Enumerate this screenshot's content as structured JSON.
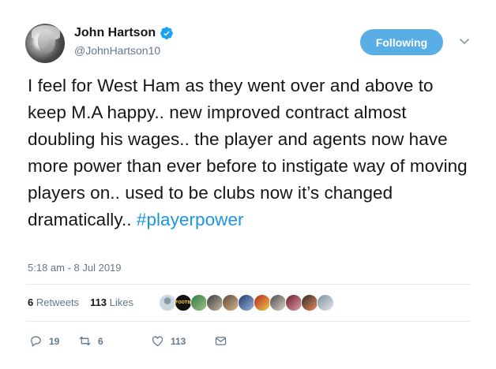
{
  "user": {
    "display_name": "John Hartson",
    "handle": "@JohnHartson10",
    "verified": true,
    "avatar_icon": "profile-photo"
  },
  "follow_button": {
    "label": "Following",
    "color": "#5aaee6"
  },
  "tweet": {
    "text_before_hashtag": "I feel for West Ham as they went over and above to keep M.A happy.. new improved contract almost doubling his wages.. the player and agents now have more power than ever before to instigate way of moving players on.. used to be clubs now it’s changed dramatically.. ",
    "hashtag": "#playerpower",
    "hashtag_color": "#1b95e0",
    "timestamp": "5:18 am - 8 Jul 2019"
  },
  "stats": {
    "retweets_count": "6",
    "retweets_label": "Retweets",
    "likes_count": "113",
    "likes_label": "Likes"
  },
  "likers": [
    {
      "icon": "default-avatar"
    },
    {
      "icon": "footballs-avatar",
      "text": "FOOTBALL"
    },
    {
      "icon": "user-avatar"
    },
    {
      "icon": "user-avatar"
    },
    {
      "icon": "user-avatar"
    },
    {
      "icon": "user-avatar"
    },
    {
      "icon": "user-avatar"
    },
    {
      "icon": "user-avatar"
    },
    {
      "icon": "user-avatar"
    },
    {
      "icon": "user-avatar"
    },
    {
      "icon": "user-avatar"
    }
  ],
  "actions": {
    "reply_count": "19",
    "retweet_count": "6",
    "like_count": "113"
  }
}
